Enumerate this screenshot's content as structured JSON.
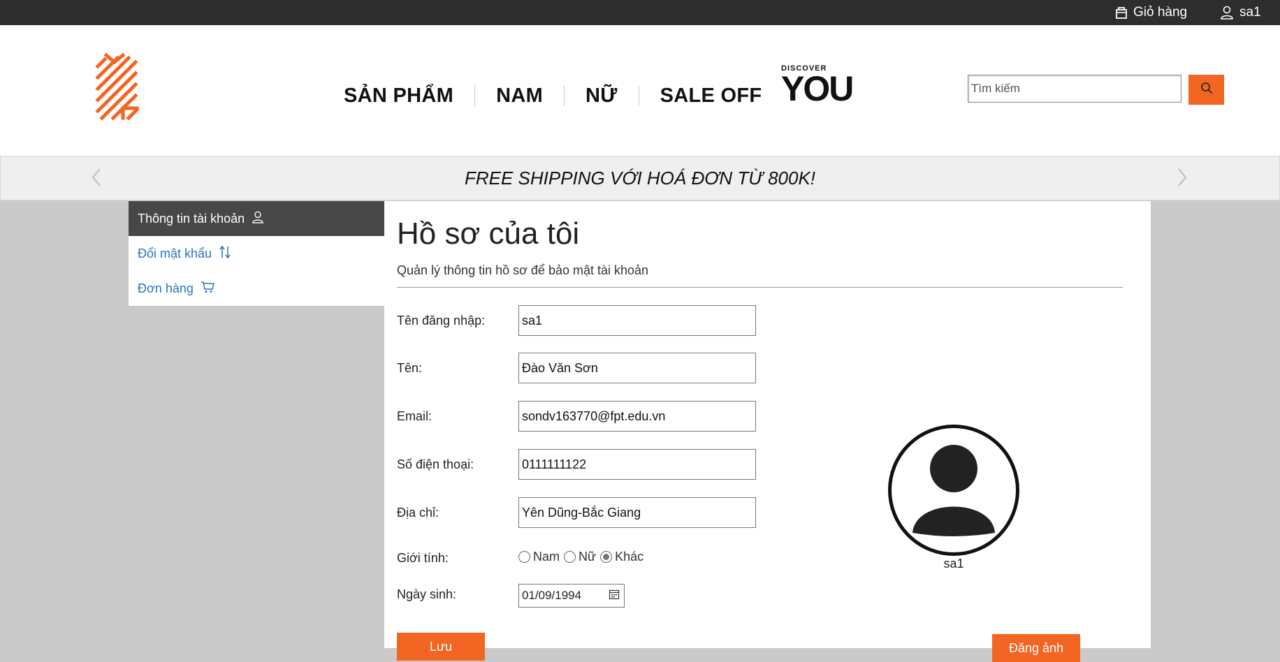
{
  "topbar": {
    "cart_label": "Giỏ hàng",
    "user_label": "sa1"
  },
  "nav": {
    "items": [
      "SẢN PHẨM",
      "NAM",
      "NỮ",
      "SALE OFF"
    ],
    "discover_small": "DISCOVER",
    "discover_big": "YOU"
  },
  "search": {
    "placeholder": "Tìm kiếm"
  },
  "banner": {
    "text": "FREE SHIPPING VỚI HOÁ ĐƠN TỪ 800K!"
  },
  "sidebar": {
    "items": [
      {
        "label": "Thông tin tài khoản",
        "icon": "user-icon"
      },
      {
        "label": "Đổi mật khẩu",
        "icon": "swap-arrows-icon"
      },
      {
        "label": "Đơn hàng",
        "icon": "cart-icon"
      }
    ]
  },
  "profile": {
    "title": "Hồ sơ của tôi",
    "subtitle": "Quản lý thông tin hồ sơ để bảo mật tài khoản",
    "fields": [
      {
        "label": "Tên đăng nhập:",
        "value": "sa1"
      },
      {
        "label": "Tên:",
        "value": "Đào Văn Sơn"
      },
      {
        "label": "Email:",
        "value": "sondv163770@fpt.edu.vn"
      },
      {
        "label": "Số điện thoại:",
        "value": "0111111122"
      },
      {
        "label": "Địa chỉ:",
        "value": "Yên Dũng-Bắc Giang"
      }
    ],
    "gender_label": "Giới tính:",
    "gender_options": [
      "Nam",
      "Nữ",
      "Khác"
    ],
    "gender_selected": "Khác",
    "dob_label": "Ngày sinh:",
    "dob_value": "01/09/1994",
    "avatar_name": "sa1",
    "save_button": "Lưu",
    "upload_button": "Đăng ảnh"
  },
  "colors": {
    "accent": "#f26522",
    "topbar": "#2d2d2d",
    "link": "#2a74c4",
    "sidebar_active": "#474747"
  }
}
